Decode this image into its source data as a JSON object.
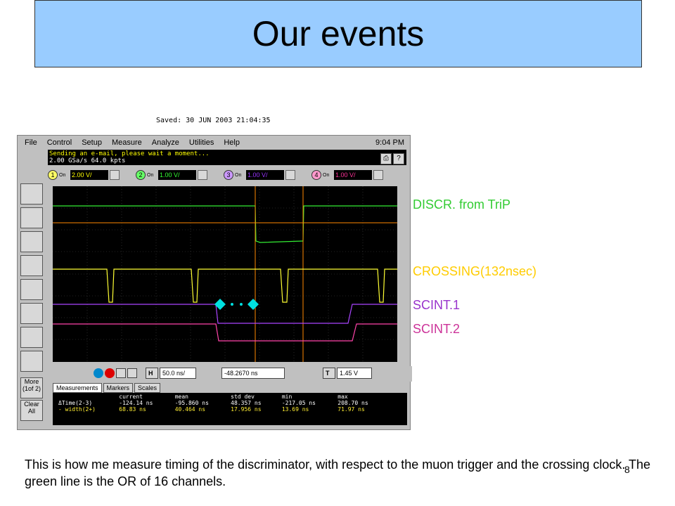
{
  "title": "Our events",
  "saved_text": "Saved:  30 JUN 2003  21:04:35",
  "menu": [
    "File",
    "Control",
    "Setup",
    "Measure",
    "Analyze",
    "Utilities",
    "Help"
  ],
  "clock": "9:04 PM",
  "status": {
    "line1": "Sending an e-mail, please wait a moment...",
    "line2": "2.00 GSa/s   64.0 kpts"
  },
  "channels": [
    {
      "num": "1",
      "on": "On",
      "value": "2.00 V/",
      "color": "#ffff00"
    },
    {
      "num": "2",
      "on": "On",
      "value": "1.00 V/",
      "color": "#33ff33"
    },
    {
      "num": "3",
      "on": "On",
      "value": "1.00 V/",
      "color": "#9933ff"
    },
    {
      "num": "4",
      "on": "On",
      "value": "1.00 V/",
      "color": "#ff3399"
    }
  ],
  "left_buttons": {
    "more": "More (1of 2)",
    "clear": "Clear All"
  },
  "controls": {
    "h_label": "H",
    "timebase": "50.0 ns/",
    "delay": "-48.2670 ns",
    "t_label": "T",
    "trigger": "1.45 V"
  },
  "tabs": [
    "Measurements",
    "Markers",
    "Scales"
  ],
  "measurements": {
    "headers": [
      "",
      "current",
      "mean",
      "std dev",
      "min",
      "max"
    ],
    "rows": [
      [
        "ΔTime(2-3)",
        "-124.14 ns",
        "-95.860 ns",
        "48.357 ns",
        "-217.05 ns",
        "208.70 ns"
      ],
      [
        "- width(2+)",
        "68.83 ns",
        "40.464 ns",
        "17.956 ns",
        "13.69 ns",
        "71.97 ns"
      ]
    ]
  },
  "annotations": {
    "discr": "DISCR. from TriP",
    "crossing": "CROSSING(132nsec)",
    "scint1": "SCINT.1",
    "scint2": "SCINT.2"
  },
  "colors": {
    "title_bg": "#99ccff",
    "green": "#33cc33",
    "yellow": "#ffcc00",
    "purple": "#9933cc",
    "magenta": "#cc3399",
    "marker": "#ff8800",
    "diamond": "#00dddd"
  },
  "footer": "This is how me measure timing of the discriminator, with respect to the muon trigger and the crossing clock. The green line is the OR of 16 channels.",
  "slide_number": "8"
}
